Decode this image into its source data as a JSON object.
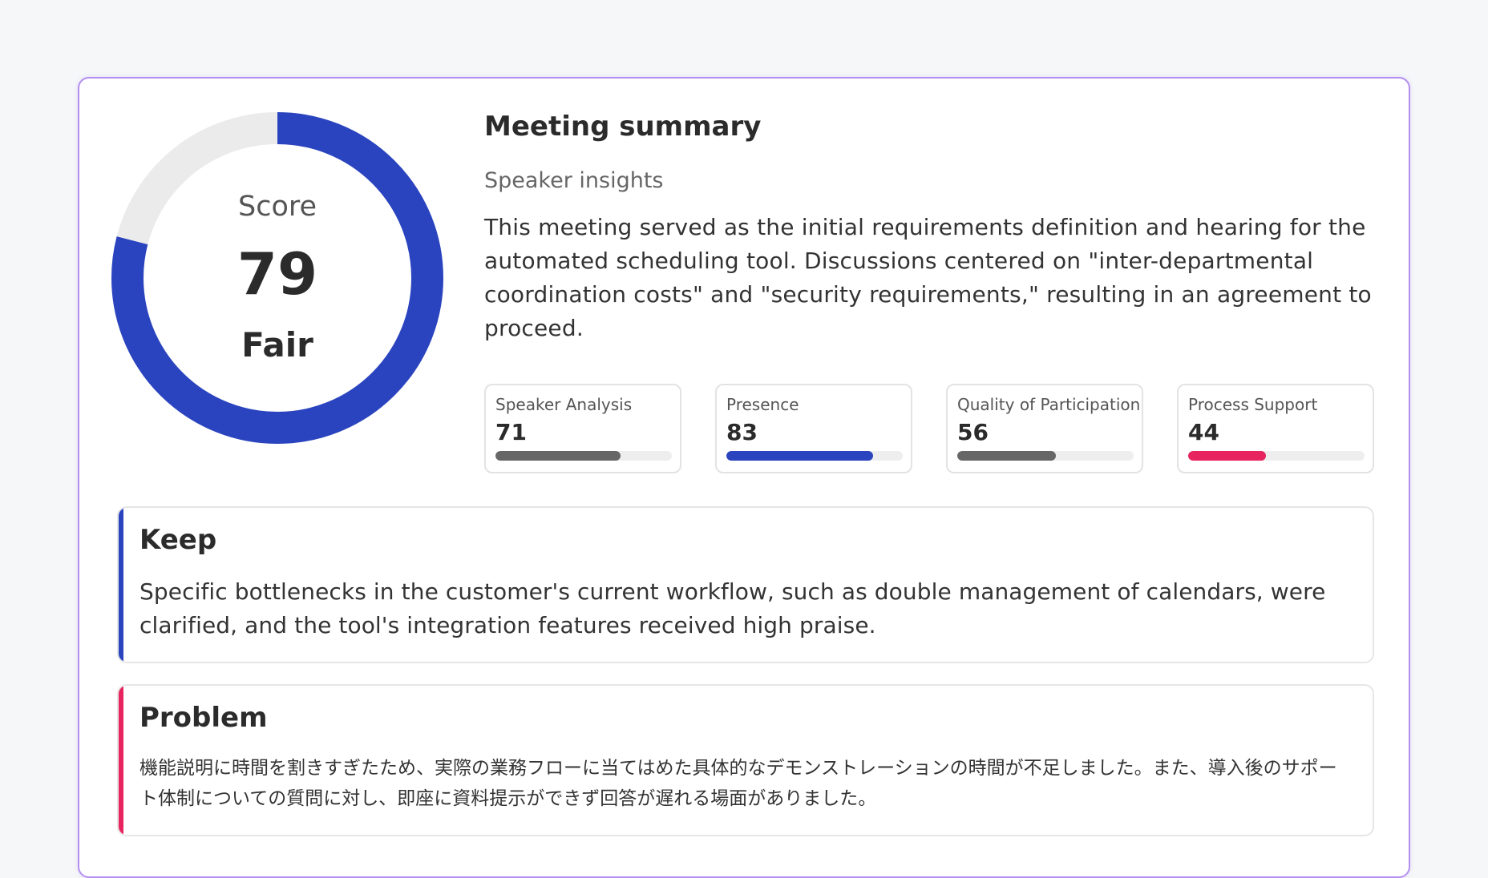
{
  "score_gauge": {
    "label": "Score",
    "value": 79,
    "value_text": "79",
    "rating": "Fair",
    "max": 100,
    "fill_color": "#2a44bf",
    "track_color": "#ebebeb"
  },
  "summary": {
    "title": "Meeting summary",
    "subtitle": "Speaker insights",
    "body": "This meeting served as the initial requirements definition and hearing for the automated scheduling tool. Discussions centered on \"inter-departmental coordination costs\" and \"security requirements,\" resulting in an agreement to proceed."
  },
  "metrics": [
    {
      "label": "Speaker Analysis",
      "value": 71,
      "value_text": "71",
      "color": "#666666"
    },
    {
      "label": "Presence",
      "value": 83,
      "value_text": "83",
      "color": "#2a44bf"
    },
    {
      "label": "Quality of Participation",
      "value": 56,
      "value_text": "56",
      "color": "#666666"
    },
    {
      "label": "Process Support",
      "value": 44,
      "value_text": "44",
      "color": "#e8245f"
    }
  ],
  "keep": {
    "title": "Keep",
    "body": "Specific bottlenecks in the customer's current workflow, such as double management of calendars, were clarified, and the tool's integration features received high praise.",
    "accent_color": "#2a44bf"
  },
  "problem": {
    "title": "Problem",
    "body": "機能説明に時間を割きすぎたため、実際の業務フローに当てはめた具体的なデモンストレーションの時間が不足しました。また、導入後のサポート体制についての質問に対し、即座に資料提示ができず回答が遅れる場面がありました。",
    "accent_color": "#e8245f"
  }
}
